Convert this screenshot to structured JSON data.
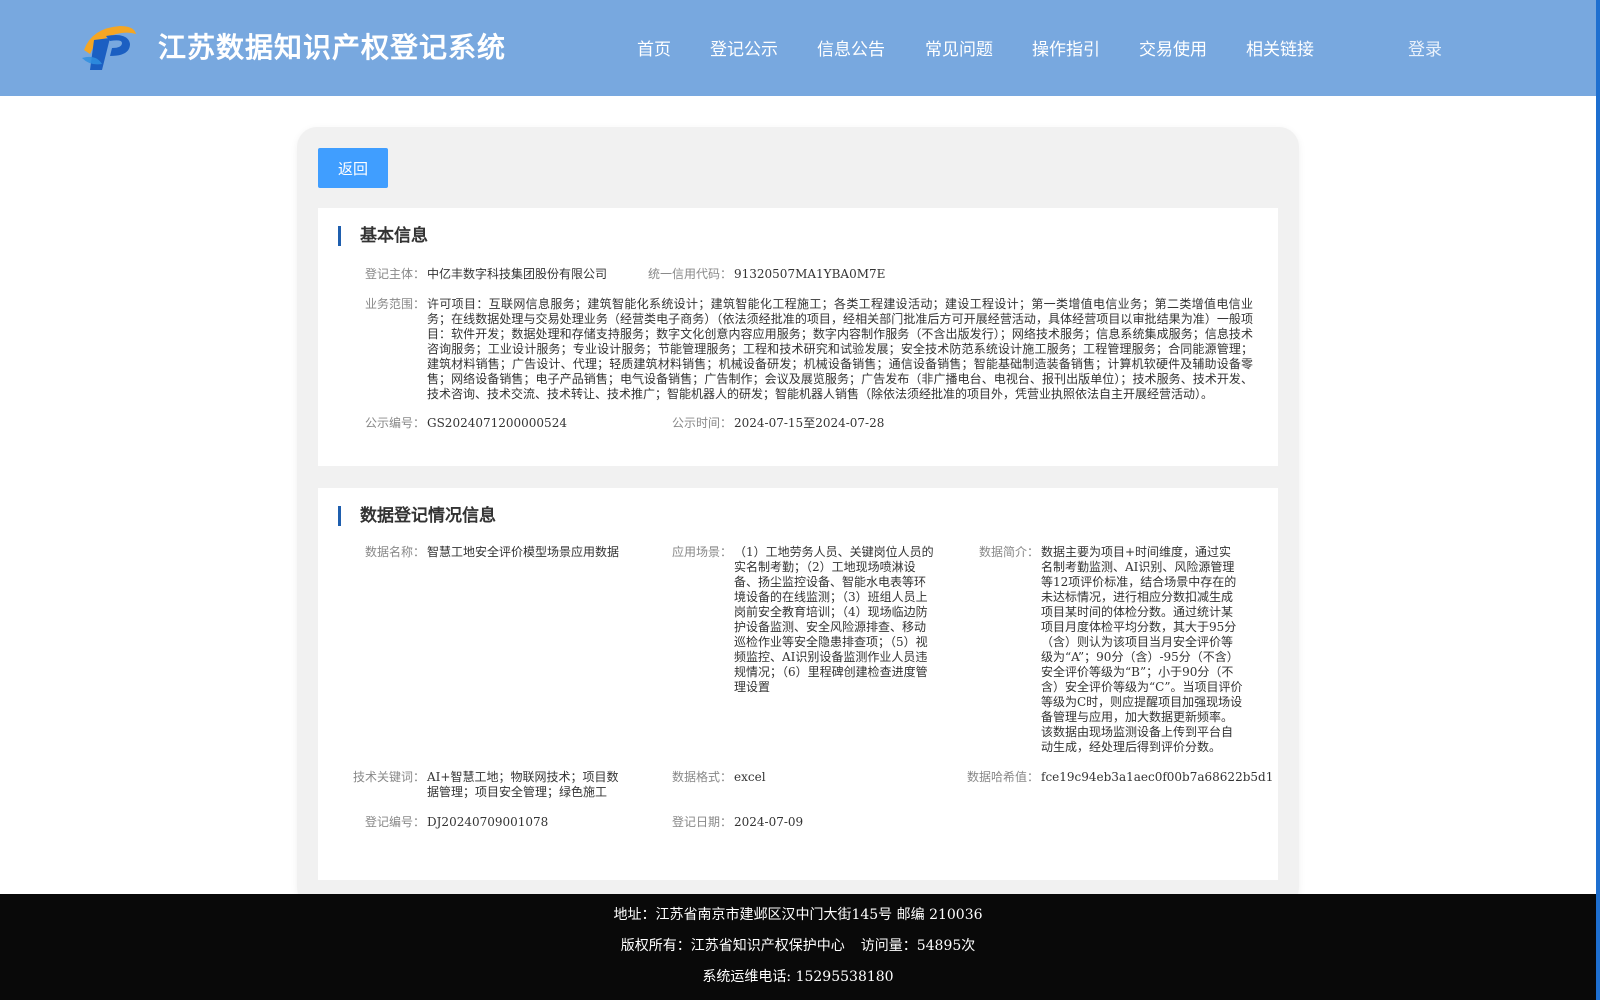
{
  "header": {
    "title": "江苏数据知识产权登记系统",
    "nav": [
      "首页",
      "登记公示",
      "信息公告",
      "常见问题",
      "操作指引",
      "交易使用",
      "相关链接"
    ],
    "login": "登录",
    "colors": {
      "header_bg": "#78a8df",
      "accent": "#409eff"
    }
  },
  "toolbar": {
    "back_label": "返回"
  },
  "basic_info": {
    "title": "基本信息",
    "subject_label": "登记主体：",
    "subject": "中亿丰数字科技集团股份有限公司",
    "credit_code_label": "统一信用代码：",
    "credit_code": "91320507MA1YBA0M7E",
    "business_scope_label": "业务范围：",
    "business_scope": "许可项目：互联网信息服务；建筑智能化系统设计；建筑智能化工程施工；各类工程建设活动；建设工程设计；第一类增值电信业务；第二类增值电信业务；在线数据处理与交易处理业务（经营类电子商务）（依法须经批准的项目，经相关部门批准后方可开展经营活动，具体经营项目以审批结果为准）一般项目：软件开发；数据处理和存储支持服务；数字文化创意内容应用服务；数字内容制作服务（不含出版发行）；网络技术服务；信息系统集成服务；信息技术咨询服务；工业设计服务；专业设计服务；节能管理服务；工程和技术研究和试验发展；安全技术防范系统设计施工服务；工程管理服务；合同能源管理；建筑材料销售；广告设计、代理；轻质建筑材料销售；机械设备研发；机械设备销售；通信设备销售；智能基础制造装备销售；计算机软硬件及辅助设备零售；网络设备销售；电子产品销售；电气设备销售；广告制作；会议及展览服务；广告发布（非广播电台、电视台、报刊出版单位）；技术服务、技术开发、技术咨询、技术交流、技术转让、技术推广；智能机器人的研发；智能机器人销售（除依法须经批准的项目外，凭营业执照依法自主开展经营活动）。",
    "publicity_no_label": "公示编号：",
    "publicity_no": "GS2024071200000524",
    "publicity_time_label": "公示时间：",
    "publicity_time": "2024-07-15至2024-07-28"
  },
  "data_info": {
    "title": "数据登记情况信息",
    "data_name_label": "数据名称：",
    "data_name": "智慧工地安全评价模型场景应用数据",
    "scenario_label": "应用场景：",
    "scenario": "（1）工地劳务人员、关键岗位人员的实名制考勤；（2）工地现场喷淋设备、扬尘监控设备、智能水电表等环境设备的在线监测；（3）班组人员上岗前安全教育培训；（4）现场临边防护设备监测、安全风险源排查、移动巡检作业等安全隐患排查项；（5）视频监控、AI识别设备监测作业人员违规情况；（6）里程碑创建检查进度管理设置",
    "summary_label": "数据简介：",
    "summary": "数据主要为项目+时间维度，通过实名制考勤监测、AI识别、风险源管理等12项评价标准，结合场景中存在的未达标情况，进行相应分数扣减生成项目某时间的体检分数。通过统计某项目月度体检平均分数，其大于95分（含）则认为该项目当月安全评价等级为“A”；90分（含）-95分（不含）安全评价等级为“B”；小于90分（不含）安全评价等级为“C”。当项目评价等级为C时，则应提醒项目加强现场设备管理与应用，加大数据更新频率。该数据由现场监测设备上传到平台自动生成，经处理后得到评价分数。",
    "keywords_label": "技术关键词：",
    "keywords": "AI+智慧工地；物联网技术；项目数据管理；项目安全管理；绿色施工",
    "format_label": "数据格式：",
    "format": "excel",
    "hash_label": "数据哈希值：",
    "hash": "fce19c94eb3a1aec0f00b7a68622b5d1",
    "reg_no_label": "登记编号：",
    "reg_no": "DJ20240709001078",
    "reg_date_label": "登记日期：",
    "reg_date": "2024-07-09"
  },
  "footer": {
    "address": "地址：江苏省南京市建邺区汉中门大街145号 邮编 210036",
    "copyright": "版权所有：江苏省知识产权保护中心",
    "visits": "访问量：54895次",
    "phone": "系统运维电话: 15295538180"
  }
}
